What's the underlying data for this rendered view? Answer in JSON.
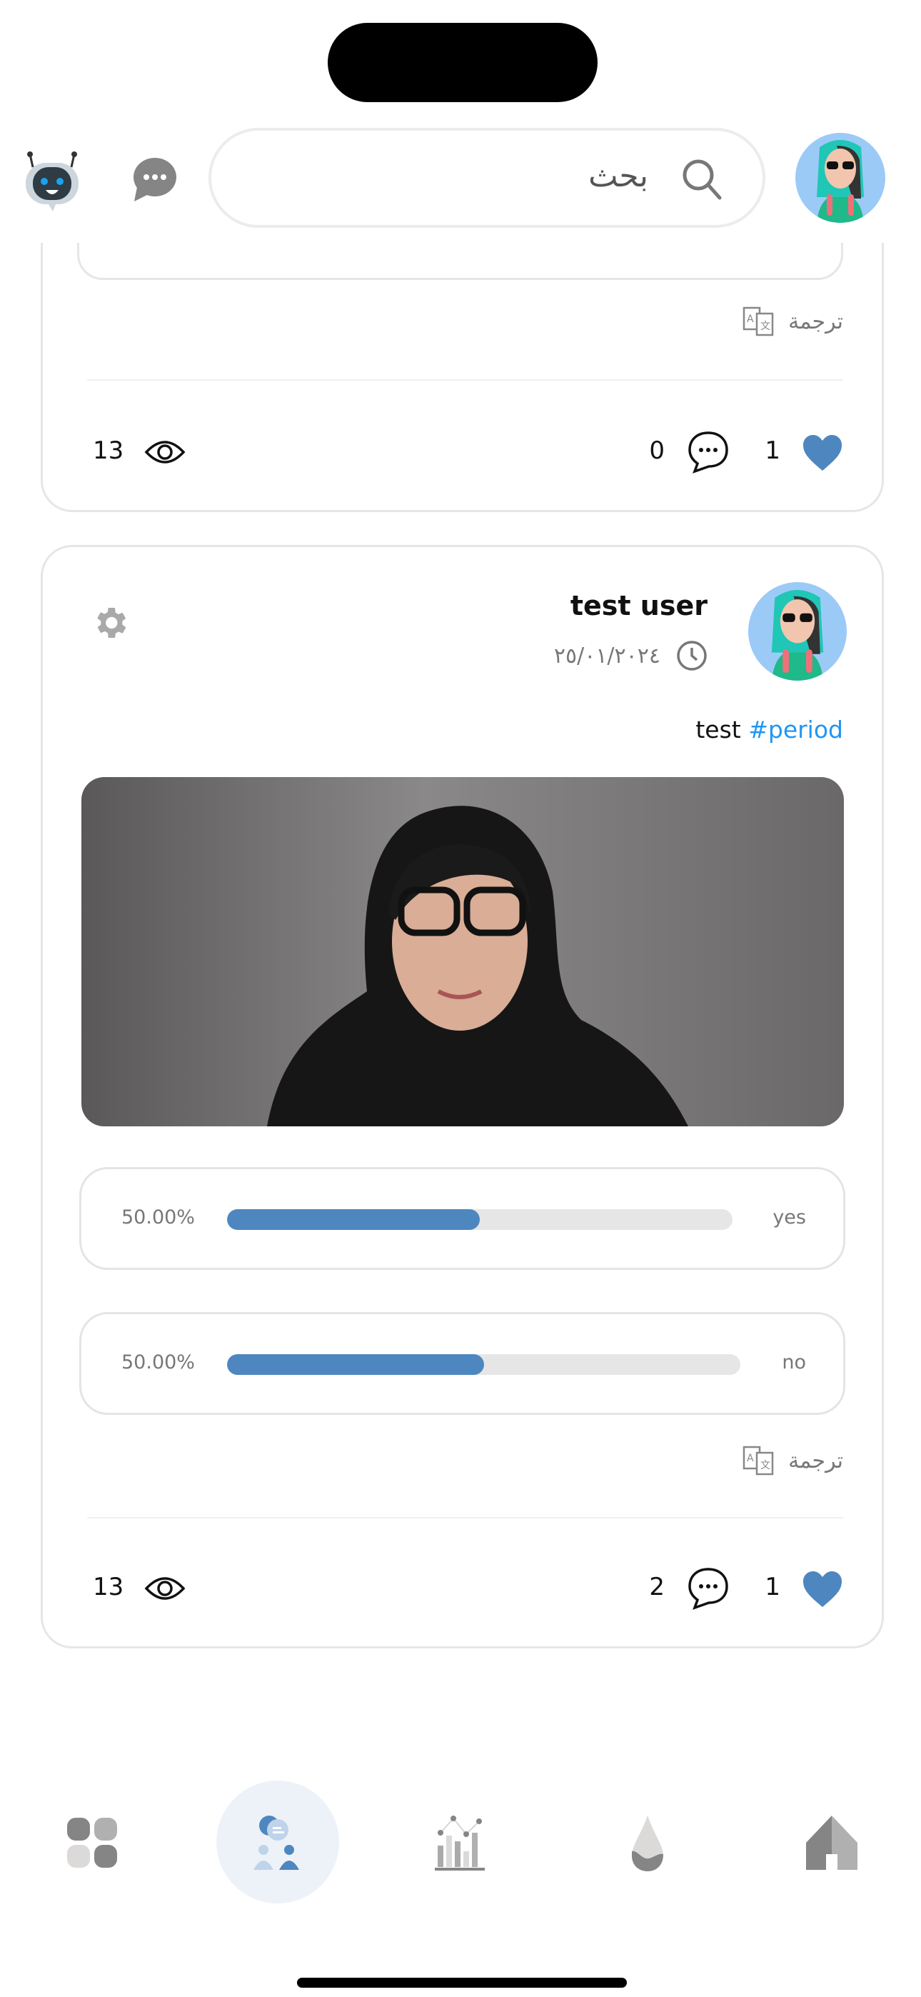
{
  "header": {
    "search_placeholder": "بحث"
  },
  "previous_post": {
    "translate_label": "ترجمة",
    "likes": "1",
    "comments": "0",
    "views": "13"
  },
  "post": {
    "author": "test user",
    "date": "٢٥/٠١/٢٠٢٤",
    "text": "test",
    "hashtag": "#period",
    "poll": [
      {
        "label": "yes",
        "percent_text": "50.00%",
        "fraction": 0.5
      },
      {
        "label": "no",
        "percent_text": "50.00%",
        "fraction": 0.5
      }
    ],
    "translate_label": "ترجمة",
    "likes": "1",
    "comments": "2",
    "views": "13"
  },
  "colors": {
    "accent": "#4e87c0",
    "hashtag": "#2196f3",
    "active_nav_bg": "#edf2f9"
  },
  "nav": [
    {
      "icon": "grid-icon"
    },
    {
      "icon": "community-icon",
      "active": true
    },
    {
      "icon": "chart-icon"
    },
    {
      "icon": "drop-icon"
    },
    {
      "icon": "home-icon"
    }
  ]
}
